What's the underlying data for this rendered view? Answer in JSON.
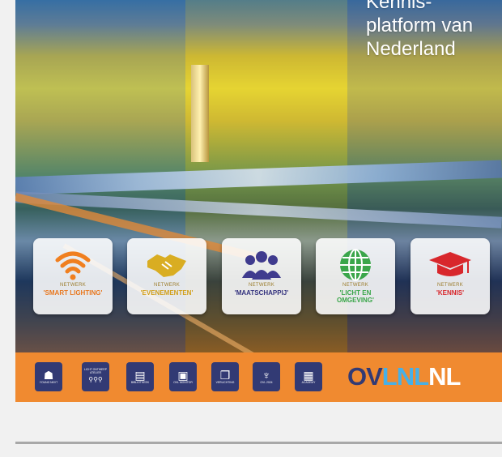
{
  "headline": {
    "line1": "Kennis-",
    "line2": "platform van",
    "line3": "Nederland"
  },
  "tiles": [
    {
      "small": "NETWERK",
      "name": "'SMART LIGHTING'",
      "icon": "wifi-icon",
      "color": "#f07f1f",
      "name_color": "#e8781f"
    },
    {
      "small": "NETWERK",
      "name": "'EVENEMENTEN'",
      "icon": "handshake-icon",
      "color": "#d9ad22",
      "name_color": "#d19f1a"
    },
    {
      "small": "NETWERK",
      "name": "'MAATSCHAPPIJ'",
      "icon": "people-icon",
      "color": "#3f3b8e",
      "name_color": "#34327e"
    },
    {
      "small": "NETWERK",
      "name_line1": "'LICHT EN",
      "name_line2": "OMGEVING'",
      "icon": "globe-icon",
      "color": "#3aa64a",
      "name_color": "#3aa64a"
    },
    {
      "small": "NETWERK",
      "name": "'KENNIS'",
      "icon": "graduation-cap-icon",
      "color": "#d8272c",
      "name_color": "#d8272c"
    }
  ],
  "badges": [
    {
      "label": "YOUNG NKVT",
      "sub": "",
      "icon": "young-professional-icon"
    },
    {
      "label": "LICHT ONTWERP ATELIER",
      "sub": "",
      "icon": "atelier-icon"
    },
    {
      "label": "BIBLIOTHEEK",
      "sub": "",
      "icon": "books-icon"
    },
    {
      "label": "OVL MONITOR",
      "sub": "",
      "icon": "monitor-icon"
    },
    {
      "label": "VERLICHTING",
      "sub": "",
      "icon": "book-icon"
    },
    {
      "label": "OVL 2024",
      "sub": "",
      "icon": "award-icon"
    },
    {
      "label": "ACADEMY",
      "sub": "",
      "icon": "document-icon"
    }
  ],
  "logo": {
    "part1": "OV",
    "part2": "LNL",
    "part3": "NL"
  },
  "colors": {
    "bar": "#f08a30",
    "badge": "#323a74",
    "logo_blue": "#46b0e8"
  }
}
